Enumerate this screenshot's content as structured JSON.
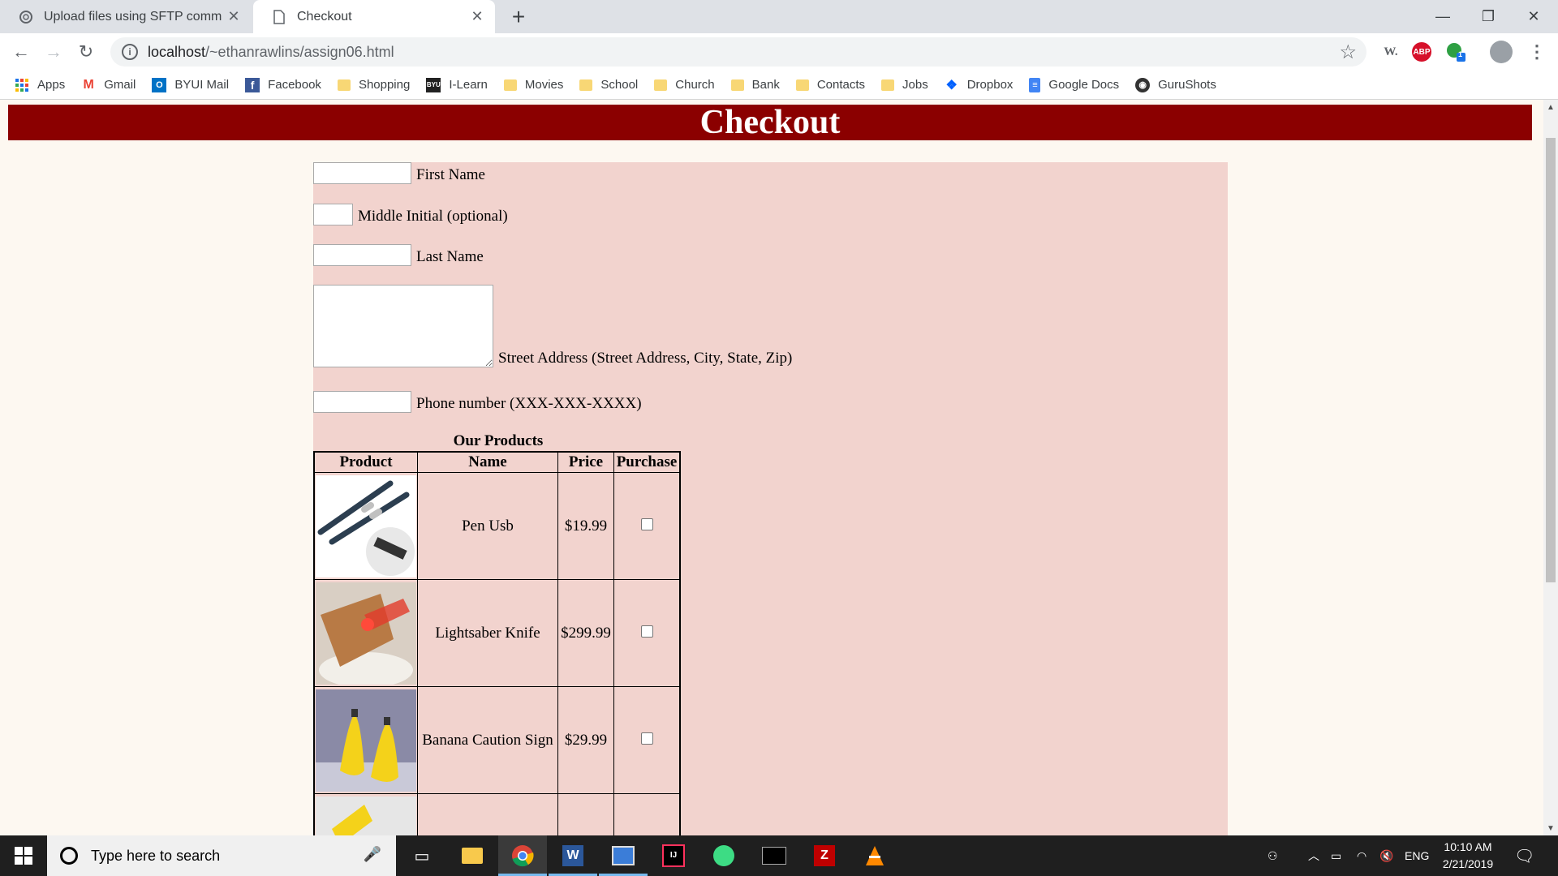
{
  "browser": {
    "tabs": [
      {
        "title": "Upload files using SFTP comman",
        "icon": "globe-icon",
        "active": false
      },
      {
        "title": "Checkout",
        "icon": "page-icon",
        "active": true
      }
    ],
    "new_tab": "+",
    "window_controls": {
      "minimize": "—",
      "restore": "❐",
      "close": "✕"
    },
    "url": {
      "host": "localhost",
      "path": "/~ethanrawlins/assign06.html"
    },
    "extensions": {
      "w": "W.",
      "abp": "ABP",
      "badge": "1"
    },
    "bookmarks": [
      {
        "label": "Apps",
        "icon": "apps-grid-icon"
      },
      {
        "label": "Gmail",
        "icon": "gmail-icon"
      },
      {
        "label": "BYUI Mail",
        "icon": "outlook-icon"
      },
      {
        "label": "Facebook",
        "icon": "facebook-icon"
      },
      {
        "label": "Shopping",
        "icon": "folder-icon"
      },
      {
        "label": "I-Learn",
        "icon": "byui-icon"
      },
      {
        "label": "Movies",
        "icon": "folder-icon"
      },
      {
        "label": "School",
        "icon": "folder-icon"
      },
      {
        "label": "Church",
        "icon": "folder-icon"
      },
      {
        "label": "Bank",
        "icon": "folder-icon"
      },
      {
        "label": "Contacts",
        "icon": "folder-icon"
      },
      {
        "label": "Jobs",
        "icon": "folder-icon"
      },
      {
        "label": "Dropbox",
        "icon": "dropbox-icon"
      },
      {
        "label": "Google Docs",
        "icon": "google-docs-icon"
      },
      {
        "label": "GuruShots",
        "icon": "gurushots-icon"
      }
    ]
  },
  "page": {
    "title": "Checkout",
    "colors": {
      "header_bg": "#8b0000",
      "form_bg": "#f2d3ce",
      "page_bg": "#fdf8f1"
    },
    "form": {
      "first_name_label": "First Name",
      "middle_initial_label": "Middle Initial (optional)",
      "last_name_label": "Last Name",
      "address_label": "Street Address (Street Address, City, State, Zip)",
      "phone_label": "Phone number (XXX-XXX-XXXX)",
      "first_name_value": "",
      "middle_initial_value": "",
      "last_name_value": "",
      "address_value": "",
      "phone_value": ""
    },
    "products_caption": "Our Products",
    "table_headers": [
      "Product",
      "Name",
      "Price",
      "Purchase"
    ],
    "products": [
      {
        "name": "Pen Usb",
        "price": "$19.99",
        "image": "pen-usb-image",
        "checked": false
      },
      {
        "name": "Lightsaber Knife",
        "price": "$299.99",
        "image": "lightsaber-knife-image",
        "checked": false
      },
      {
        "name": "Banana Caution Sign",
        "price": "$29.99",
        "image": "banana-caution-sign-image",
        "checked": false
      },
      {
        "name": "",
        "price": "",
        "image": "partial-product-image",
        "checked": false
      }
    ]
  },
  "taskbar": {
    "search_placeholder": "Type here to search",
    "apps": [
      "task-view-icon",
      "file-explorer-icon",
      "chrome-icon",
      "word-icon",
      "network-app-icon",
      "intellij-icon",
      "android-studio-icon",
      "terminal-icon",
      "filezilla-icon",
      "vlc-icon"
    ],
    "language": "ENG",
    "time": "10:10 AM",
    "date": "2/21/2019"
  }
}
